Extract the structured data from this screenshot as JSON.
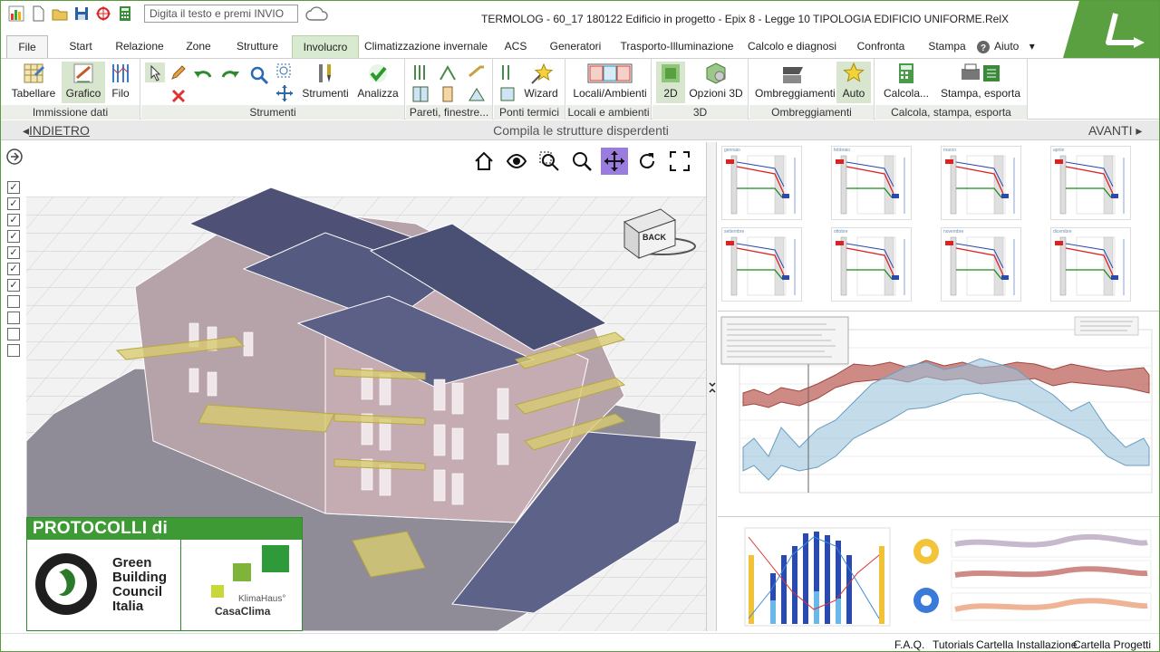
{
  "titlebar": {
    "search_placeholder": "Digita il testo e premi INVIO",
    "window_title": "TERMOLOG - 60_17 180122 Edificio in progetto - Epix 8 - Legge 10 TIPOLOGIA EDIFICIO UNIFORME.RelX"
  },
  "tabs": [
    "File",
    "Start",
    "Relazione",
    "Zone",
    "Strutture",
    "Involucro",
    "Climatizzazione invernale",
    "ACS",
    "Generatori",
    "Trasporto-Illuminazione",
    "Calcolo e diagnosi",
    "Confronta",
    "Stampa",
    "Aiuto"
  ],
  "active_tab": "Involucro",
  "ribbon": {
    "buttons": [
      "Tabellare",
      "Grafico",
      "Filo",
      "Strumenti",
      "Analizza",
      "Wizard",
      "Locali/Ambienti",
      "2D",
      "Opzioni 3D",
      "Ombreggiamenti",
      "Auto",
      "Calcola...",
      "Stampa, esporta"
    ],
    "groups": [
      "Immissione dati",
      "Strumenti",
      "Pareti, finestre...",
      "Ponti termici",
      "Locali e ambienti",
      "3D",
      "Ombreggiamenti",
      "Calcola, stampa, esporta"
    ]
  },
  "navbar": {
    "back": "INDIETRO",
    "title": "Compila le strutture disperdenti",
    "forward": "AVANTI"
  },
  "viewcube": "BACK",
  "checkboxes": [
    true,
    true,
    true,
    true,
    true,
    true,
    true,
    false,
    false,
    false,
    false
  ],
  "months_top": [
    "gennaio",
    "febbraio",
    "marzo",
    "aprile"
  ],
  "months_bottom": [
    "settembre",
    "ottobre",
    "novembre",
    "dicembre"
  ],
  "protocol": {
    "header": "PROTOCOLLI di SOSTENIBILITÀ",
    "gbc_name": "Green Building Council Italia",
    "gbc_line1": "Green",
    "gbc_line2": "Building",
    "gbc_line3": "Council",
    "gbc_line4": "Italia",
    "klima_small": "KlimaHaus°",
    "casaclima": "CasaClima"
  },
  "status_links": [
    "F.A.Q.",
    "Tutorials",
    "Cartella Installazione",
    "Cartella Progetti"
  ],
  "colors": {
    "accent": "#3d9a35",
    "ribbon_active": "#d8ead0",
    "vt_active": "#9a7be0"
  }
}
